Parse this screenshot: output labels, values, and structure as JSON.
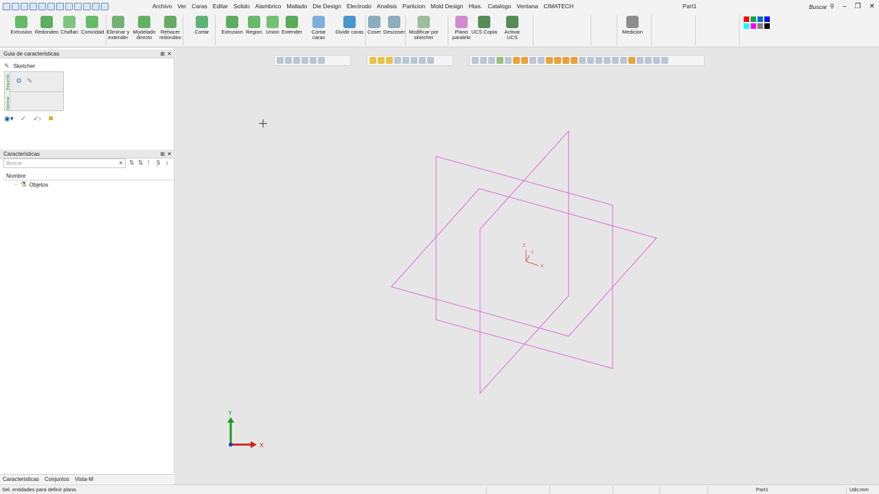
{
  "titlebar": {
    "menu": [
      "Archivo",
      "Ver",
      "Caras",
      "Editar",
      "Solido",
      "Alambrico",
      "Mallado",
      "Die Design",
      "Electrodo",
      "Analisis",
      "Particion",
      "Mold Design",
      "Htas.",
      "Catalogo",
      "Ventana",
      "CIMATECH"
    ],
    "doc_title": "Part1",
    "search_label": "Buscar"
  },
  "ribbon": {
    "buttons": [
      {
        "label": "Extrusion"
      },
      {
        "label": "Redondeo"
      },
      {
        "label": "Chaflan"
      },
      {
        "label": "Conicidad"
      },
      {
        "label": "Eliminar y extender"
      },
      {
        "label": "Modelado directo"
      },
      {
        "label": "Rehacer redondeo"
      },
      {
        "label": "Cortar"
      },
      {
        "label": "Extrusion"
      },
      {
        "label": "Region"
      },
      {
        "label": "Union"
      },
      {
        "label": "Extender"
      },
      {
        "label": "Cortar caras"
      },
      {
        "label": "Dividir caras"
      },
      {
        "label": "Coser"
      },
      {
        "label": "Descoser"
      },
      {
        "label": "Modificar por sketcher"
      },
      {
        "label": "Plano paralelo"
      },
      {
        "label": "UCS Copia"
      },
      {
        "label": "Activar UCS"
      },
      {
        "label": "Medicion"
      }
    ],
    "colors": [
      "#ff0000",
      "#00a651",
      "#0070c0",
      "#0000ff",
      "#00ffff",
      "#ff00ff",
      "#7f7f7f",
      "#000000"
    ]
  },
  "guide_panel": {
    "title": "Guia de caracteristicas",
    "sketcher_label": "Sketcher",
    "tab_required": "Requerido",
    "tab_optional": "Opcional"
  },
  "features_panel": {
    "title": "Caracteristicas",
    "search_placeholder": "Buscar",
    "column_name": "Nombre",
    "tree_items": [
      "Objetos"
    ]
  },
  "bottom_tabs": [
    "Caracteristicas",
    "Conjuntos",
    "Vista-M"
  ],
  "viewport": {
    "axis_labels": {
      "x": "X",
      "y": "Y"
    },
    "ucs_labels": {
      "x": "X",
      "y": "Y",
      "z": "Z"
    },
    "plane_color": "#e06ad8"
  },
  "statusbar": {
    "message": "Sel. entidades para definir plano.",
    "part": "Part1",
    "units": "Uds:mm"
  }
}
